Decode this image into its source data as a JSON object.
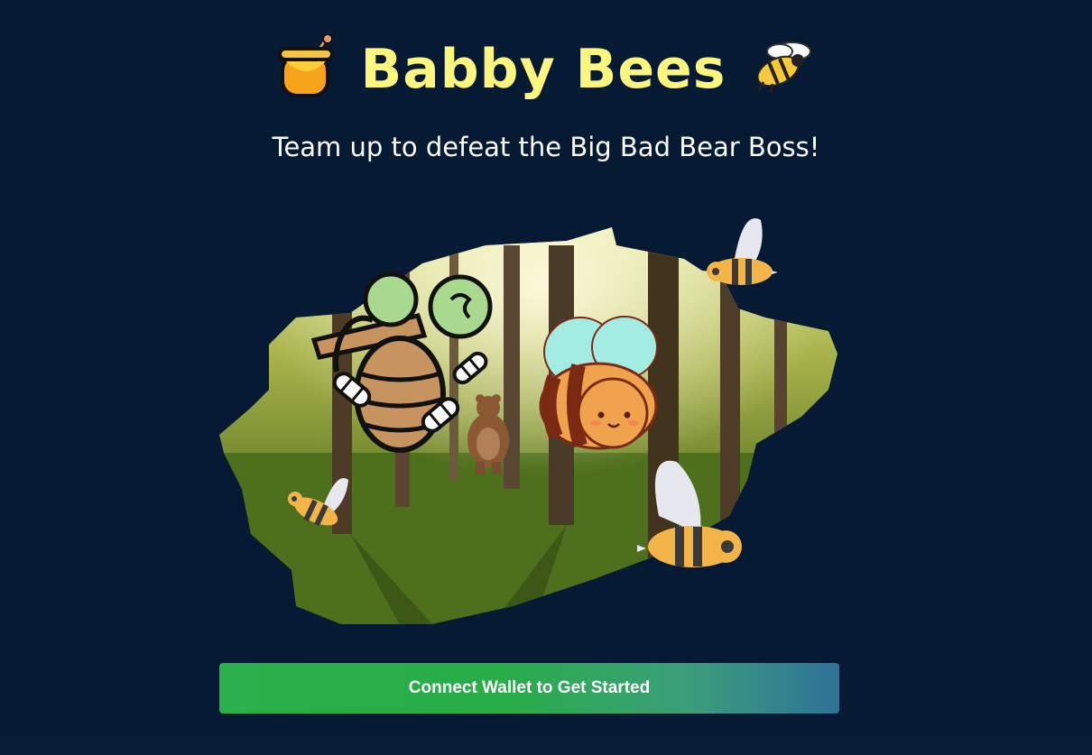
{
  "header": {
    "title": "Babby Bees",
    "left_icon": "honey-pot-icon",
    "right_icon": "bee-icon"
  },
  "hero": {
    "subtitle": "Team up to defeat the Big Bad Bear Boss!",
    "illustration": [
      "forest-background",
      "beehive-icon",
      "bear-icon",
      "cartoon-bee-icon",
      "small-bee-icon"
    ]
  },
  "cta": {
    "label": "Connect Wallet to Get Started"
  },
  "colors": {
    "background": "#061a33",
    "title": "#fdf67e",
    "subtitle": "#ffffff",
    "button_start": "#2ab04c",
    "button_end": "#2f7297"
  }
}
